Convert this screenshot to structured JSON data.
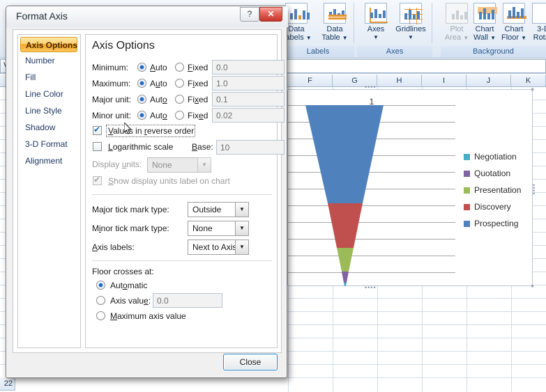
{
  "app": {
    "name_box_value": "Vertical (Value) Axis",
    "ribbon_groups": [
      {
        "name": "Labels",
        "buttons": [
          {
            "label_line1": "Data",
            "label_line2": "Labels",
            "icon": "data-labels-icon",
            "dropdown": true,
            "disabled": false
          },
          {
            "label_line1": "Data",
            "label_line2": "Table",
            "icon": "data-table-icon",
            "dropdown": true,
            "disabled": false
          }
        ]
      },
      {
        "name": "Axes",
        "buttons": [
          {
            "label_line1": "Axes",
            "label_line2": "",
            "icon": "axes-icon",
            "dropdown": true,
            "disabled": false
          },
          {
            "label_line1": "Gridlines",
            "label_line2": "",
            "icon": "gridlines-icon",
            "dropdown": true,
            "disabled": false
          }
        ]
      },
      {
        "name": "Background",
        "buttons": [
          {
            "label_line1": "Plot",
            "label_line2": "Area",
            "icon": "plot-area-icon",
            "dropdown": true,
            "disabled": true
          },
          {
            "label_line1": "Chart",
            "label_line2": "Wall",
            "icon": "chart-wall-icon",
            "dropdown": true,
            "disabled": false
          },
          {
            "label_line1": "Chart",
            "label_line2": "Floor",
            "icon": "chart-floor-icon",
            "dropdown": true,
            "disabled": false
          },
          {
            "label_line1": "3-D",
            "label_line2": "Rotati",
            "icon": "3d-rotation-icon",
            "dropdown": false,
            "disabled": false
          }
        ]
      }
    ],
    "columns": [
      "F",
      "G",
      "H",
      "I",
      "J",
      "K"
    ],
    "row_header_bottom": "22"
  },
  "chart_data": {
    "type": "bar",
    "chart_style": "inverted-funnel",
    "title": "1",
    "categories": [
      "Prospecting",
      "Discovery",
      "Presentation",
      "Quotation",
      "Negotiation"
    ],
    "values": [
      0.52,
      0.26,
      0.13,
      0.07,
      0.02
    ],
    "colors": [
      "#4f81bd",
      "#c0504d",
      "#9bbb59",
      "#8064a2",
      "#4bacc6"
    ],
    "legend": {
      "position": "right",
      "entries": [
        {
          "label": "Negotiation",
          "color": "#4bacc6"
        },
        {
          "label": "Quotation",
          "color": "#8064a2"
        },
        {
          "label": "Presentation",
          "color": "#9bbb59"
        },
        {
          "label": "Discovery",
          "color": "#c0504d"
        },
        {
          "label": "Prospecting",
          "color": "#4f81bd"
        }
      ]
    },
    "gridlines": true,
    "gridline_count": 11,
    "gridline_color": "#a6a6a6",
    "ylim": [
      0,
      1
    ],
    "xlabel": "",
    "ylabel": ""
  },
  "dialog": {
    "title": "Format Axis",
    "help_button": "?",
    "close_x": "✕",
    "nav": {
      "items": [
        {
          "label": "Axis Options",
          "selected": true
        },
        {
          "label": "Number",
          "selected": false
        },
        {
          "label": "Fill",
          "selected": false
        },
        {
          "label": "Line Color",
          "selected": false
        },
        {
          "label": "Line Style",
          "selected": false
        },
        {
          "label": "Shadow",
          "selected": false
        },
        {
          "label": "3-D Format",
          "selected": false
        },
        {
          "label": "Alignment",
          "selected": false
        }
      ]
    },
    "pane": {
      "heading": "Axis Options",
      "scale_rows": [
        {
          "label": "Minimum:",
          "auto_label": "Auto",
          "fixed_label": "Fixed",
          "selected": "auto",
          "value": "0.0"
        },
        {
          "label": "Maximum:",
          "auto_label": "Auto",
          "fixed_label": "Fixed",
          "selected": "auto",
          "value": "1.0"
        },
        {
          "label": "Major unit:",
          "auto_label": "Auto",
          "fixed_label": "Fixed",
          "selected": "auto",
          "value": "0.1"
        },
        {
          "label": "Minor unit:",
          "auto_label": "Auto",
          "fixed_label": "Fixed",
          "selected": "auto",
          "value": "0.02"
        }
      ],
      "reverse_order": {
        "label": "Values in reverse order",
        "checked": true,
        "focused": true
      },
      "log_scale": {
        "label": "Logarithmic scale",
        "checked": false,
        "base_label": "Base:",
        "base_value": "10"
      },
      "display_units": {
        "label": "Display units:",
        "value": "None",
        "disabled": true
      },
      "show_units_label": {
        "label": "Show display units label on chart",
        "checked": true,
        "disabled": true
      },
      "major_tick": {
        "label": "Major tick mark type:",
        "value": "Outside"
      },
      "minor_tick": {
        "label": "Minor tick mark type:",
        "value": "None"
      },
      "axis_labels": {
        "label": "Axis labels:",
        "value": "Next to Axis"
      },
      "floor_crosses": {
        "group_label": "Floor crosses at:",
        "options": [
          {
            "label": "Automatic",
            "selected": true,
            "value": null
          },
          {
            "label": "Axis value:",
            "selected": false,
            "value": "0.0"
          },
          {
            "label": "Maximum axis value",
            "selected": false,
            "value": null
          }
        ]
      }
    },
    "close_button": "Close"
  }
}
